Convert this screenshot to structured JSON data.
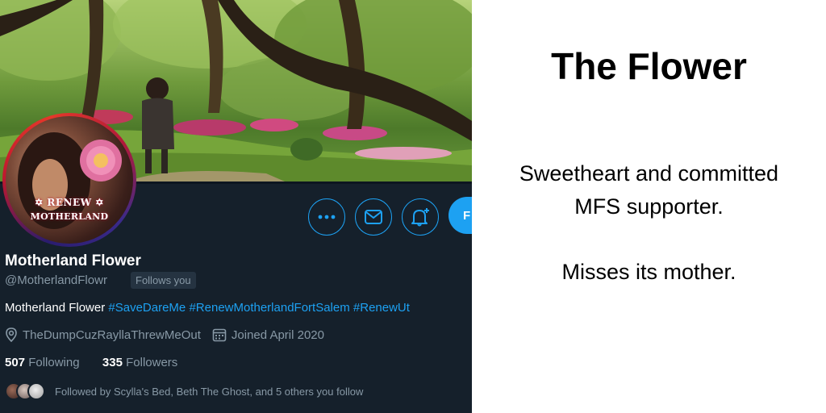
{
  "profile": {
    "display_name": "Motherland Flower",
    "handle": "@MotherlandFlowr",
    "follows_you_badge": "Follows you",
    "avatar_text": {
      "line1": "✡ RENEW ✡",
      "line2": "MOTHERLAND"
    },
    "bio": {
      "text": "Motherland Flower ",
      "hashtags": [
        "#SaveDareMe",
        "#RenewMotherlandFortSalem",
        "#RenewUt"
      ]
    },
    "location": "TheDumpCuzRayllaThrewMeOut",
    "joined": "Joined April 2020",
    "following_count": "507",
    "following_label": "Following",
    "followers_count": "335",
    "followers_label": "Followers",
    "followed_by_text": "Followed by Scylla's Bed, Beth The Ghost, and 5 others you follow",
    "follow_button_label": "F",
    "icons": [
      "more-icon",
      "message-icon",
      "notification-bell-icon",
      "location-pin-icon",
      "calendar-icon"
    ],
    "colors": {
      "background": "#15202b",
      "accent": "#1da1f2",
      "muted": "#8899a6",
      "text": "#ffffff"
    }
  },
  "caption": {
    "title": "The Flower",
    "line1": "Sweetheart and committed",
    "line2": "MFS supporter.",
    "line3": "Misses its mother."
  }
}
